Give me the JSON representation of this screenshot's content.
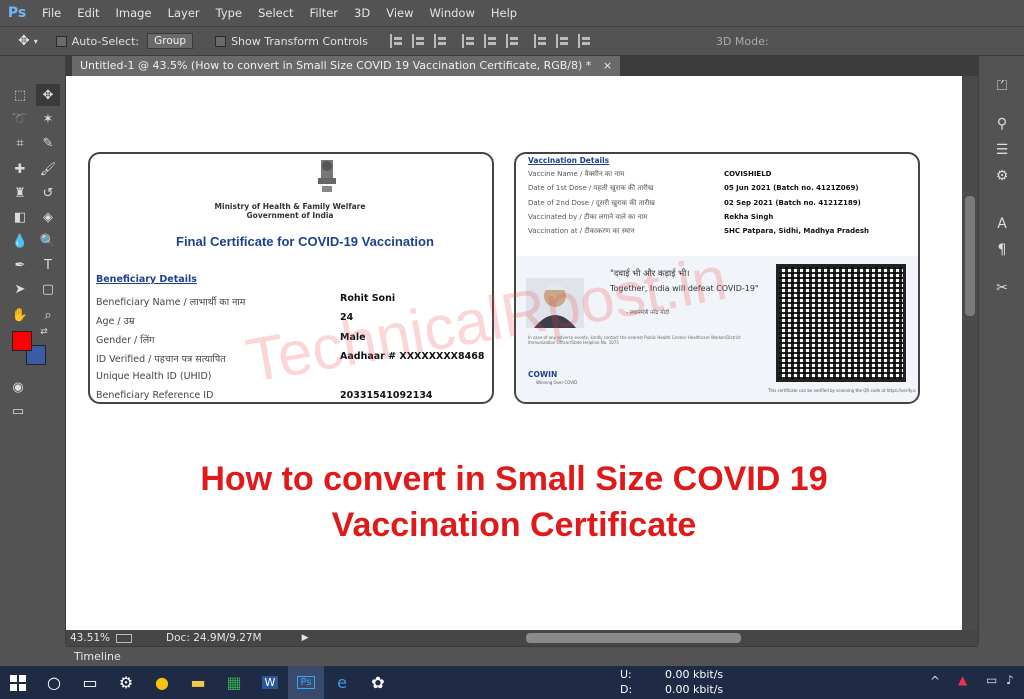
{
  "app": {
    "logo": "Ps"
  },
  "menu": [
    "File",
    "Edit",
    "Image",
    "Layer",
    "Type",
    "Select",
    "Filter",
    "3D",
    "View",
    "Window",
    "Help"
  ],
  "options": {
    "auto_select_label": "Auto-Select:",
    "auto_select_value": "Group",
    "transform_label": "Show Transform Controls",
    "mode_3d": "3D Mode:"
  },
  "document": {
    "tab_title": "Untitled-1 @ 43.5% (How to convert in Small Size COVID 19 Vaccination Certificate, RGB/8) *",
    "tab_close": "×"
  },
  "certificate": {
    "ministry": "Ministry of Health & Family Welfare",
    "government": "Government of India",
    "title": "Final Certificate for COVID-19 Vaccination",
    "section": "Beneficiary Details",
    "rows": [
      {
        "label": "Beneficiary Name / लाभार्थी का नाम",
        "value": "Rohit Soni"
      },
      {
        "label": "Age / उम्र",
        "value": "24"
      },
      {
        "label": "Gender / लिंग",
        "value": "Male"
      },
      {
        "label": "ID Verified / पहचान पत्र सत्यापित",
        "value": "Aadhaar # XXXXXXXX8468"
      },
      {
        "label": "Unique Health ID (UHID)",
        "value": ""
      },
      {
        "label": "Beneficiary Reference ID",
        "value": "20331541092134"
      }
    ]
  },
  "vaccination": {
    "section": "Vaccination Details",
    "rows": [
      {
        "label": "Vaccine Name / वैक्सीन का नाम",
        "value": "COVISHIELD"
      },
      {
        "label": "Date of 1st Dose / पहली खुराक की तारीख",
        "value": "05 Jun 2021 (Batch no. 4121Z069)"
      },
      {
        "label": "Date of 2nd Dose / दूसरी खुराक की तारीख",
        "value": "02 Sep 2021 (Batch no. 4121Z189)"
      },
      {
        "label": "Vaccinated by / टीका लगाने वाले का नाम",
        "value": "Rekha Singh"
      },
      {
        "label": "Vaccination at / टीकाकरण का स्थान",
        "value": "SHC Patpara, Sidhi, Madhya Pradesh"
      }
    ],
    "quote_hindi": "\"दवाई भी और कड़ाई भी।",
    "quote_en": "Together, India will defeat COVID-19\"",
    "quote_by": "- प्रधानमंत्री नरेंद्र मोदी",
    "helpline": "In case of any adverse events, kindly contact the nearest Public Health Center/ Healthcare Worker/District Immunization Officer/State Helpline No. 1075",
    "cowin": "COWIN",
    "cowin_sub": "Winning Over COVID",
    "verify_note": "This certificate can be verified by scanning the QR code at https://verify.cowin.gov.in"
  },
  "watermark": "TechnicalRpost.in",
  "headline": {
    "line1": "How to convert in Small Size COVID 19",
    "line2": "Vaccination Certificate"
  },
  "status": {
    "zoom": "43.51%",
    "doc": "Doc: 24.9M/9.27M"
  },
  "timeline": "Timeline",
  "taskbar": {
    "upload_label": "U:",
    "download_label": "D:",
    "upload_value": "0.00 kbit/s",
    "download_value": "0.00 kbit/s"
  },
  "colors": {
    "foreground": "#ff0000",
    "background": "#3b5ba5",
    "headline": "#e01a1a",
    "cert_title": "#1f3f8f"
  }
}
